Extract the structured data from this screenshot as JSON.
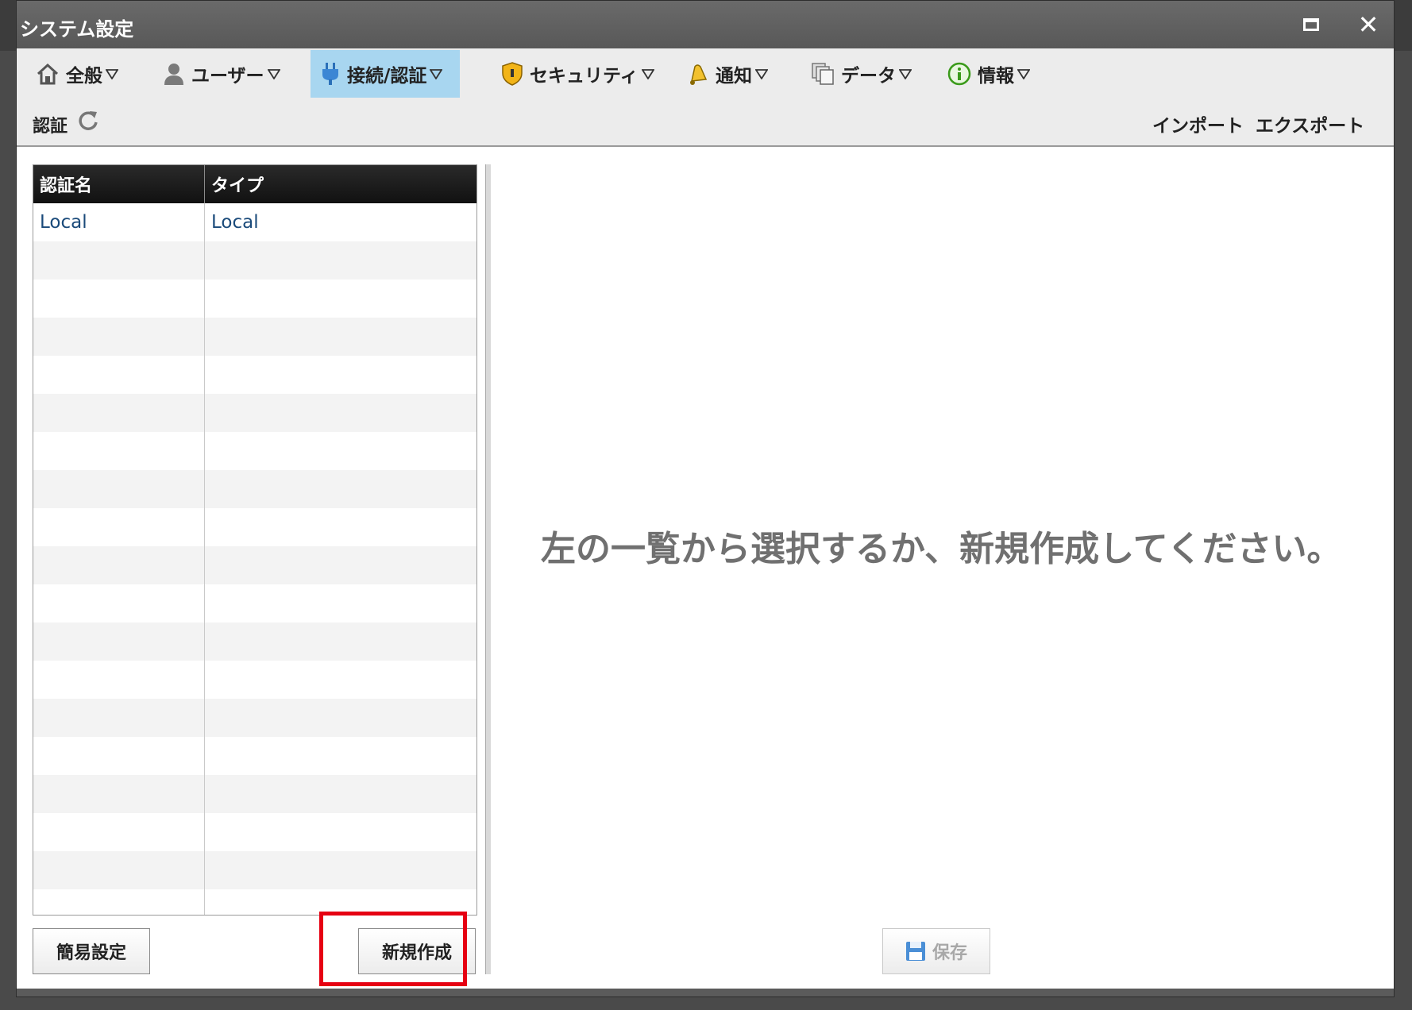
{
  "window": {
    "title": "システム設定"
  },
  "menu": [
    {
      "label": "全般",
      "icon": "home-icon"
    },
    {
      "label": "ユーザー",
      "icon": "user-icon"
    },
    {
      "label": "接続/認証",
      "icon": "plug-icon",
      "active": true
    },
    {
      "label": "セキュリティ",
      "icon": "shield-icon"
    },
    {
      "label": "通知",
      "icon": "bell-icon"
    },
    {
      "label": "データ",
      "icon": "copy-icon"
    },
    {
      "label": "情報",
      "icon": "info-icon"
    }
  ],
  "section": {
    "label": "認証"
  },
  "actions": {
    "import_label": "インポート",
    "export_label": "エクスポート"
  },
  "table": {
    "headers": [
      "認証名",
      "タイプ"
    ],
    "rows": [
      {
        "name": "Local",
        "type": "Local"
      }
    ]
  },
  "main": {
    "placeholder": "左の一覧から選択するか、新規作成してください。"
  },
  "buttons": {
    "simple_setup": "簡易設定",
    "new_create": "新規作成",
    "save": "保存"
  },
  "colors": {
    "active_menu": "#a8d6f0",
    "highlight": "#e60012"
  }
}
